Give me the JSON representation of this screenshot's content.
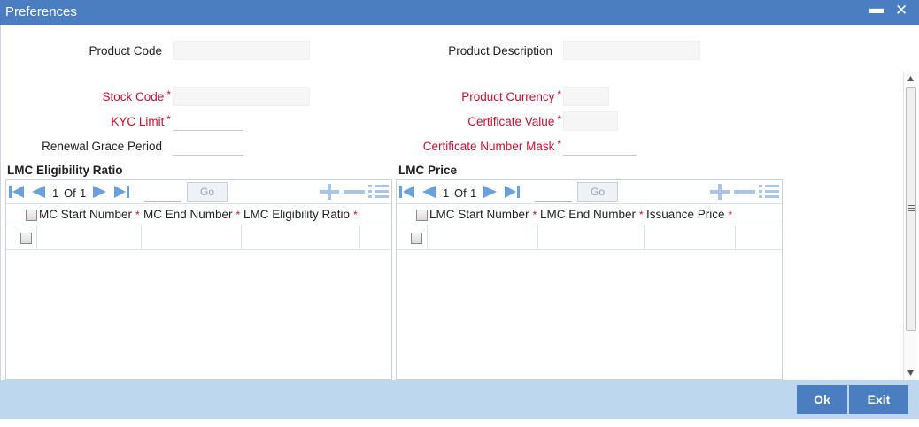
{
  "window": {
    "title": "Preferences",
    "minimize_glyph": "▬",
    "close_glyph": "✕"
  },
  "form": {
    "product_code": {
      "label": "Product Code",
      "value": ""
    },
    "product_description": {
      "label": "Product Description",
      "value": ""
    },
    "stock_code": {
      "label": "Stock Code",
      "required_mark": "*",
      "value": ""
    },
    "product_currency": {
      "label": "Product Currency",
      "required_mark": "*",
      "value": ""
    },
    "kyc_limit": {
      "label": "KYC Limit",
      "required_mark": "*",
      "value": ""
    },
    "certificate_value": {
      "label": "Certificate Value",
      "required_mark": "*",
      "value": ""
    },
    "renewal_grace_period": {
      "label": "Renewal Grace Period",
      "value": ""
    },
    "certificate_number_mask": {
      "label": "Certificate Number Mask",
      "required_mark": "*",
      "value": ""
    }
  },
  "grids": {
    "eligibility": {
      "title": "LMC Eligibility Ratio",
      "page_current": "1",
      "page_of": "Of",
      "page_total": "1",
      "go_label": "Go",
      "columns": [
        {
          "label": "MC Start Number",
          "required_mark": "*"
        },
        {
          "label": "MC End Number",
          "required_mark": "*"
        },
        {
          "label": "LMC Eligibility Ratio",
          "required_mark": "*"
        }
      ]
    },
    "price": {
      "title": "LMC Price",
      "page_current": "1",
      "page_of": "Of",
      "page_total": "1",
      "go_label": "Go",
      "columns": [
        {
          "label": "LMC Start Number",
          "required_mark": "*"
        },
        {
          "label": "LMC End Number",
          "required_mark": "*"
        },
        {
          "label": "Issuance Price",
          "required_mark": "*"
        }
      ]
    }
  },
  "footer": {
    "ok_label": "Ok",
    "exit_label": "Exit"
  },
  "colors": {
    "titlebar": "#4a7ec1",
    "footer": "#bdd7ee",
    "required": "#c8102e",
    "nav_icons": "#6aa0dc"
  }
}
